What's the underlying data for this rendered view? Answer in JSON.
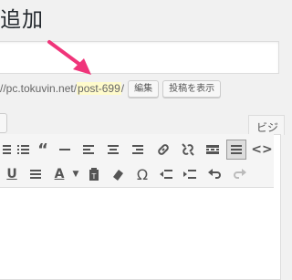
{
  "page": {
    "title": "追加"
  },
  "permalink": {
    "url_prefix": "//pc.tokuvin.net/",
    "slug": "post-699",
    "trailing": "/",
    "edit_button": "編集",
    "view_button": "投稿を表示"
  },
  "editor": {
    "tab_visual": "ビジ"
  },
  "toolbar": {
    "row1": [
      "align-left-icon",
      "list-icon",
      "blockquote-icon",
      "horizontal-rule-icon",
      "align-left-icon",
      "align-center-icon",
      "align-right-icon",
      "link-icon",
      "unlink-icon",
      "read-more-icon",
      "toolbar-toggle-icon",
      "code-icon"
    ],
    "row2": [
      "underline-icon",
      "justify-icon",
      "text-color-icon",
      "paste-text-icon",
      "clear-format-icon",
      "special-char-icon",
      "outdent-icon",
      "indent-icon",
      "undo-icon",
      "redo-icon"
    ],
    "text_color_letter": "A",
    "omega": "Ω"
  },
  "annotation": {
    "arrow_color": "#f0357a"
  }
}
